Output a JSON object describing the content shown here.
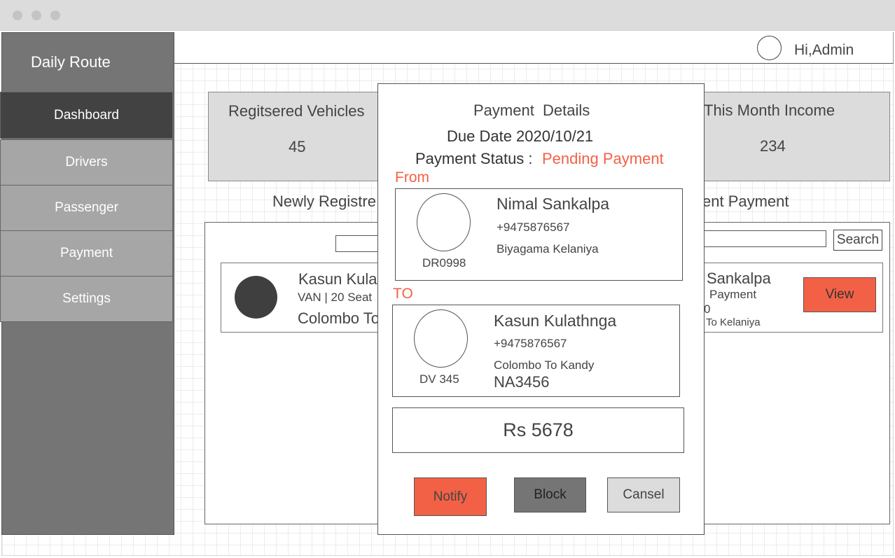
{
  "app": {
    "title": "Daily Route"
  },
  "header": {
    "greeting": "Hi,Admin"
  },
  "sidebar": {
    "items": [
      {
        "label": "Dashboard",
        "active": true
      },
      {
        "label": "Drivers"
      },
      {
        "label": "Passenger"
      },
      {
        "label": "Payment"
      },
      {
        "label": "Settings"
      }
    ]
  },
  "stats": {
    "vehicles": {
      "label": "Regitsered Vehicles",
      "value": "45"
    },
    "income": {
      "label": "This Month Income",
      "value": "234"
    }
  },
  "sections": {
    "newly_registered": "Newly Registre",
    "pending_payment": "ent Payment"
  },
  "search": {
    "button_label": "Search"
  },
  "list_left": {
    "name": "Kasun Kula",
    "detail": "VAN | 20 Seat",
    "route": "Colombo To"
  },
  "list_right": {
    "name": "Sankalpa",
    "status": "Payment",
    "id_fragment": "0",
    "route": "To Kelaniya",
    "view_label": "View"
  },
  "modal": {
    "title": "Payment  Details",
    "due_date": "Due Date 2020/10/21",
    "status_label": "Payment Status : ",
    "status_value": "Pending Payment",
    "from_label": "From",
    "to_label": "TO",
    "from": {
      "name": "Nimal Sankalpa",
      "phone": "+9475876567",
      "address": "Biyagama Kelaniya",
      "id": "DR0998"
    },
    "to": {
      "name": "Kasun Kulathnga",
      "phone": "+9475876567",
      "route": "Colombo To Kandy",
      "vehicle": "NA3456",
      "id": "DV 345"
    },
    "amount": "Rs 5678",
    "buttons": {
      "notify": "Notify",
      "block": "Block",
      "cancel": "Cansel"
    }
  },
  "colors": {
    "accent": "#f26146",
    "sidebar": "#757575",
    "sidebar_active": "#424242",
    "nav_item": "#a6a6a6",
    "block_button": "#757575",
    "cancel_button": "#dcdcdc"
  }
}
